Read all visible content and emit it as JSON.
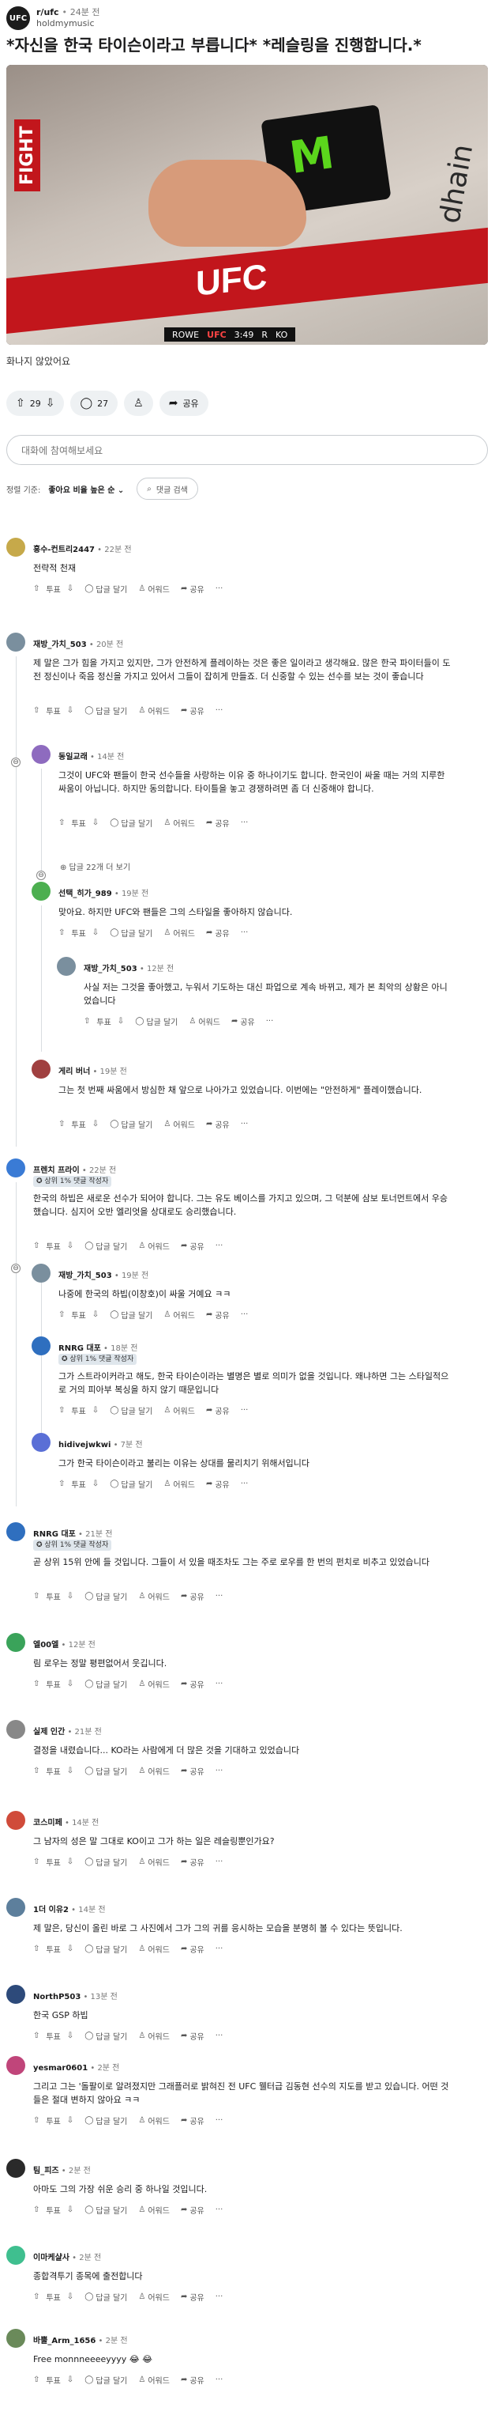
{
  "header": {
    "subreddit": "r/ufc",
    "time": "24분 전",
    "user": "holdmymusic"
  },
  "post": {
    "title": "*자신을 한국 타이슨이라고 부릅니다* *레슬링을 진행합니다.*",
    "body": "화나지 않았어요",
    "media": {
      "banner_text": "UFC",
      "can_logo": "M",
      "fight_text": "FIGHT",
      "scoreboard": {
        "left": "ROWE",
        "logo": "UFC",
        "time": "3:49",
        "round": "R",
        "right": "KO"
      },
      "sponsor_text": "dhain"
    },
    "votes": "29",
    "comments": "27",
    "share": "공유"
  },
  "join_placeholder": "대화에 참여해보세요",
  "sort": {
    "label": "정렬 기준:",
    "value": "좋아요 비율 높은 순 ⌄",
    "search": "댓글 검색"
  },
  "action_labels": {
    "vote": "투표",
    "reply": "답글 달기",
    "award": "어워드",
    "share": "공유",
    "more": "···"
  },
  "more_replies": "⊕ 답글 22개 더 보기",
  "colors": {
    "flair_bg": "#dfe6ec",
    "line": "#d9dde1"
  },
  "comments": [
    {
      "user": "홍수-컨트리2447",
      "time": "22분 전",
      "text": "전략적 천재",
      "flair": ""
    },
    {
      "user": "재방_가치_503",
      "time": "20분 전",
      "text": "제 말은 그가 힘을 가지고 있지만, 그가 안전하게 플레이하는 것은 좋은 일이라고 생각해요. 많은 한국 파이터들이 도전 정신이나 죽음 정신을 가지고 있어서 그들이 잡히게 만들죠. 더 신중할 수 있는 선수를 보는 것이 좋습니다",
      "flair": ""
    },
    {
      "user": "동일교래",
      "time": "14분 전",
      "text": "그것이 UFC와 팬들이 한국 선수들을 사랑하는 이유 중 하나이기도 합니다. 한국인이 싸울 때는 거의 지루한 싸움이 아닙니다. 하지만 동의합니다. 타이틀을 놓고 경쟁하려면 좀 더 신중해야 합니다.",
      "flair": ""
    },
    {
      "user": "선택_히가_989",
      "time": "19분 전",
      "text": "맞아요. 하지만 UFC와 팬들은 그의 스타일을 좋아하지 않습니다.",
      "flair": ""
    },
    {
      "user": "재방_가치_503",
      "time": "12분 전",
      "text": "사실 저는 그것을 좋아했고, 누워서 기도하는 대신 파업으로 계속 바뀌고, 제가 본 최악의 상황은 아니었습니다",
      "flair": ""
    },
    {
      "user": "게리 버너",
      "time": "19분 전",
      "text": "그는 첫 번째 싸움에서 방심한 채 앞으로 나아가고 있었습니다. 이번에는 \"안전하게\" 플레이했습니다.",
      "flair": ""
    },
    {
      "user": "프렌치 프라이",
      "time": "22분 전",
      "text": "한국의 하빕은 새로운 선수가 되어야 합니다. 그는 유도 베이스를 가지고 있으며, 그 덕분에 삼보 토너먼트에서 우승했습니다. 심지어 오반 엘리엇을 상대로도 승리했습니다.",
      "flair": "상위 1% 댓글 작성자"
    },
    {
      "user": "재방_가치_503",
      "time": "19분 전",
      "text": "나중에 한국의 하빕(이창호)이 싸울 거예요 ㅋㅋ",
      "flair": ""
    },
    {
      "user": "RNRG 대포",
      "time": "18분 전",
      "text": "그가 스트라이커라고 해도, 한국 타이슨이라는 별명은 별로 의미가 없을 것입니다. 왜냐하면 그는 스타일적으로 거의 피아부 복싱을 하지 않기 때문입니다",
      "flair": "상위 1% 댓글 작성자"
    },
    {
      "user": "hidivejwkwi",
      "time": "7분 전",
      "text": "그가 한국 타이슨이라고 불리는 이유는 상대를 물리치기 위해서입니다",
      "flair": ""
    },
    {
      "user": "RNRG 대포",
      "time": "21분 전",
      "text": "곧 상위 15위 안에 들 것입니다. 그들이 서 있을 때조차도 그는 주로 로우를 한 번의 펀치로 비추고 있었습니다",
      "flair": "상위 1% 댓글 작성자"
    },
    {
      "user": "엘00엘",
      "time": "12분 전",
      "text": "림 로우는 정말 평편없어서 웃깁니다.",
      "flair": ""
    },
    {
      "user": "실제 인간",
      "time": "21분 전",
      "text": "결정을 내렸습니다... KO라는 사람에게 더 많은 것을 기대하고 있었습니다",
      "flair": ""
    },
    {
      "user": "코스미페",
      "time": "14분 전",
      "text": "그 남자의 성은 말 그대로 KO이고 그가 하는 일은 레슬링뿐인가요?",
      "flair": ""
    },
    {
      "user": "1더 이유2",
      "time": "14분 전",
      "text": "제 말은, 당신이 올린 바로 그 사진에서 그가 그의 귀를 응시하는 모습을 분명히 볼 수 있다는 뜻입니다.",
      "flair": ""
    },
    {
      "user": "NorthP503",
      "time": "13분 전",
      "text": "한국 GSP 하빕",
      "flair": ""
    },
    {
      "user": "yesmar0601",
      "time": "2분 전",
      "text": "그리고 그는 '돌팔이로 알려졌지만 그래플러로 밝혀진 전 UFC 웰터급 김동현 선수의 지도를 받고 있습니다. 어떤 것들은 절대 변하지 않아요 ㅋㅋ",
      "flair": ""
    },
    {
      "user": "팀_피즈",
      "time": "2분 전",
      "text": "아마도 그의 가장 쉬운 승리 중 하나일 것입니다.",
      "flair": ""
    },
    {
      "user": "이마케샬사",
      "time": "2분 전",
      "text": "종합격투기 종목에 출전합니다",
      "flair": ""
    },
    {
      "user": "바뿔_Arm_1656",
      "time": "2분 전",
      "text": "Free monnneeeeyyyy 😂 😂",
      "flair": ""
    }
  ]
}
